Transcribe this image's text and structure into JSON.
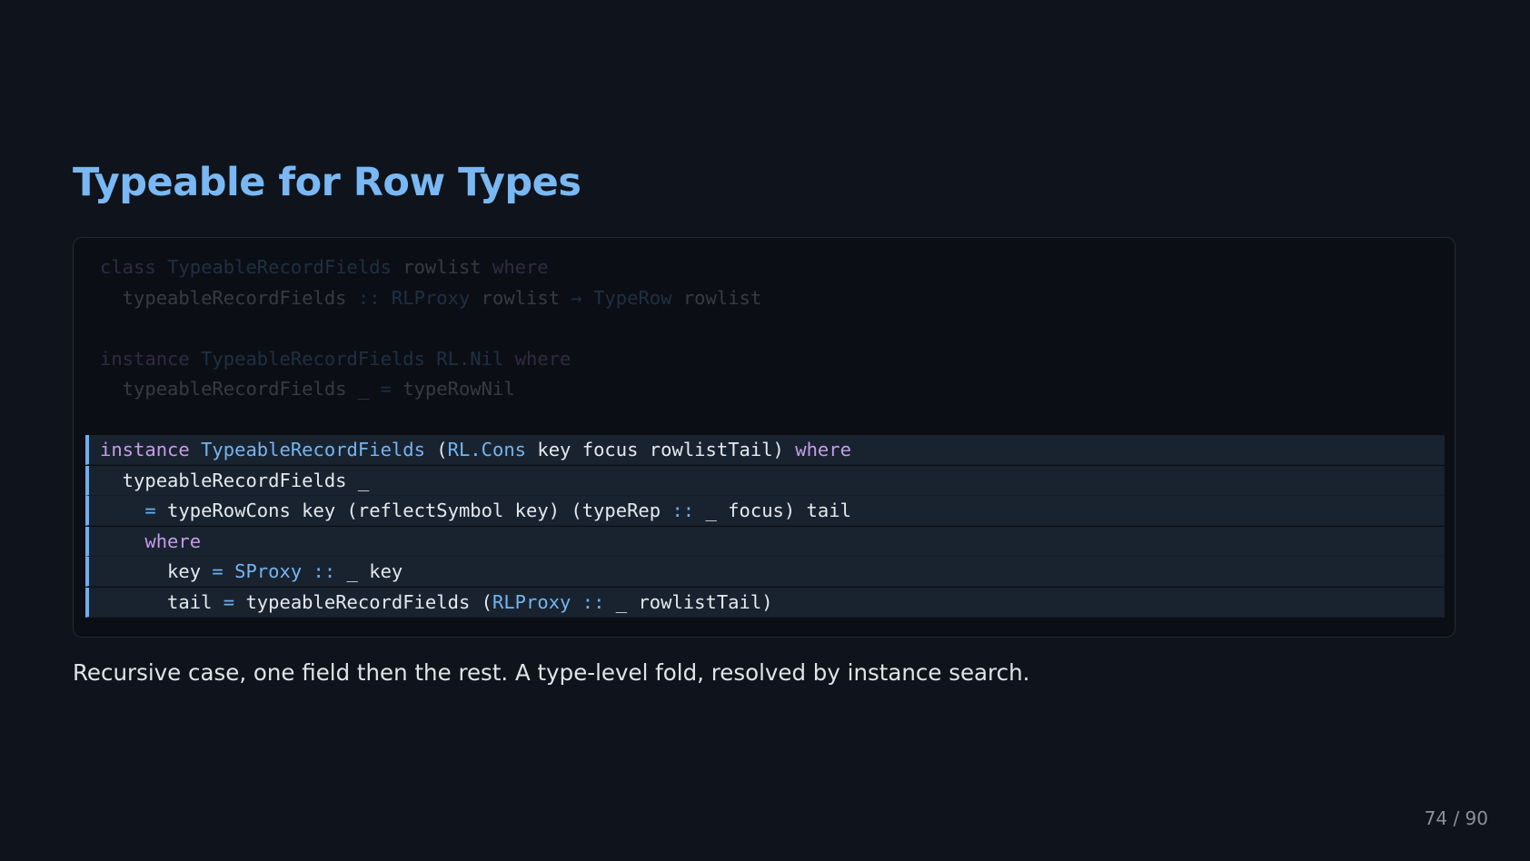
{
  "slide": {
    "title": "Typeable for Row Types",
    "caption": "Recursive case, one field then the rest. A type-level fold, resolved by instance search.",
    "page_current": "74",
    "page_separator": "/",
    "page_total": "90"
  },
  "code": {
    "lines": [
      {
        "highlighted": false,
        "tokens": [
          {
            "k": "kw",
            "t": "class"
          },
          {
            "k": "id",
            "t": " "
          },
          {
            "k": "ty",
            "t": "TypeableRecordFields"
          },
          {
            "k": "id",
            "t": " rowlist "
          },
          {
            "k": "kw",
            "t": "where"
          }
        ]
      },
      {
        "highlighted": false,
        "tokens": [
          {
            "k": "id",
            "t": "  typeableRecordFields "
          },
          {
            "k": "op",
            "t": "::"
          },
          {
            "k": "id",
            "t": " "
          },
          {
            "k": "ty",
            "t": "RLProxy"
          },
          {
            "k": "id",
            "t": " rowlist "
          },
          {
            "k": "op",
            "t": "→"
          },
          {
            "k": "id",
            "t": " "
          },
          {
            "k": "ty",
            "t": "TypeRow"
          },
          {
            "k": "id",
            "t": " rowlist"
          }
        ]
      },
      {
        "highlighted": false,
        "tokens": []
      },
      {
        "highlighted": false,
        "tokens": [
          {
            "k": "kw",
            "t": "instance"
          },
          {
            "k": "id",
            "t": " "
          },
          {
            "k": "ty",
            "t": "TypeableRecordFields"
          },
          {
            "k": "id",
            "t": " "
          },
          {
            "k": "ty",
            "t": "RL.Nil"
          },
          {
            "k": "id",
            "t": " "
          },
          {
            "k": "kw",
            "t": "where"
          }
        ]
      },
      {
        "highlighted": false,
        "tokens": [
          {
            "k": "id",
            "t": "  typeableRecordFields _ "
          },
          {
            "k": "op",
            "t": "="
          },
          {
            "k": "id",
            "t": " typeRowNil"
          }
        ]
      },
      {
        "highlighted": false,
        "tokens": []
      },
      {
        "highlighted": true,
        "tokens": [
          {
            "k": "kw",
            "t": "instance"
          },
          {
            "k": "id",
            "t": " "
          },
          {
            "k": "ty",
            "t": "TypeableRecordFields"
          },
          {
            "k": "id",
            "t": " ("
          },
          {
            "k": "ty",
            "t": "RL.Cons"
          },
          {
            "k": "id",
            "t": " key focus rowlistTail) "
          },
          {
            "k": "kw",
            "t": "where"
          }
        ]
      },
      {
        "highlighted": true,
        "tokens": [
          {
            "k": "id",
            "t": "  typeableRecordFields _"
          }
        ]
      },
      {
        "highlighted": true,
        "tokens": [
          {
            "k": "id",
            "t": "    "
          },
          {
            "k": "op",
            "t": "="
          },
          {
            "k": "id",
            "t": " typeRowCons key (reflectSymbol key) (typeRep "
          },
          {
            "k": "op",
            "t": "::"
          },
          {
            "k": "id",
            "t": " _ focus) tail"
          }
        ]
      },
      {
        "highlighted": true,
        "tokens": [
          {
            "k": "id",
            "t": "    "
          },
          {
            "k": "kw",
            "t": "where"
          }
        ]
      },
      {
        "highlighted": true,
        "tokens": [
          {
            "k": "id",
            "t": "      key "
          },
          {
            "k": "op",
            "t": "="
          },
          {
            "k": "id",
            "t": " "
          },
          {
            "k": "ty",
            "t": "SProxy"
          },
          {
            "k": "id",
            "t": " "
          },
          {
            "k": "op",
            "t": "::"
          },
          {
            "k": "id",
            "t": " _ key"
          }
        ]
      },
      {
        "highlighted": true,
        "tokens": [
          {
            "k": "id",
            "t": "      tail "
          },
          {
            "k": "op",
            "t": "="
          },
          {
            "k": "id",
            "t": " typeableRecordFields ("
          },
          {
            "k": "ty",
            "t": "RLProxy"
          },
          {
            "k": "id",
            "t": " "
          },
          {
            "k": "op",
            "t": "::"
          },
          {
            "k": "id",
            "t": " _ rowlistTail)"
          }
        ]
      }
    ]
  },
  "colors": {
    "background": "#0f131b",
    "title": "#79b8f3",
    "keyword": "#c79cea",
    "type": "#74b5f2",
    "highlight_bar": "#6cb0f0"
  }
}
